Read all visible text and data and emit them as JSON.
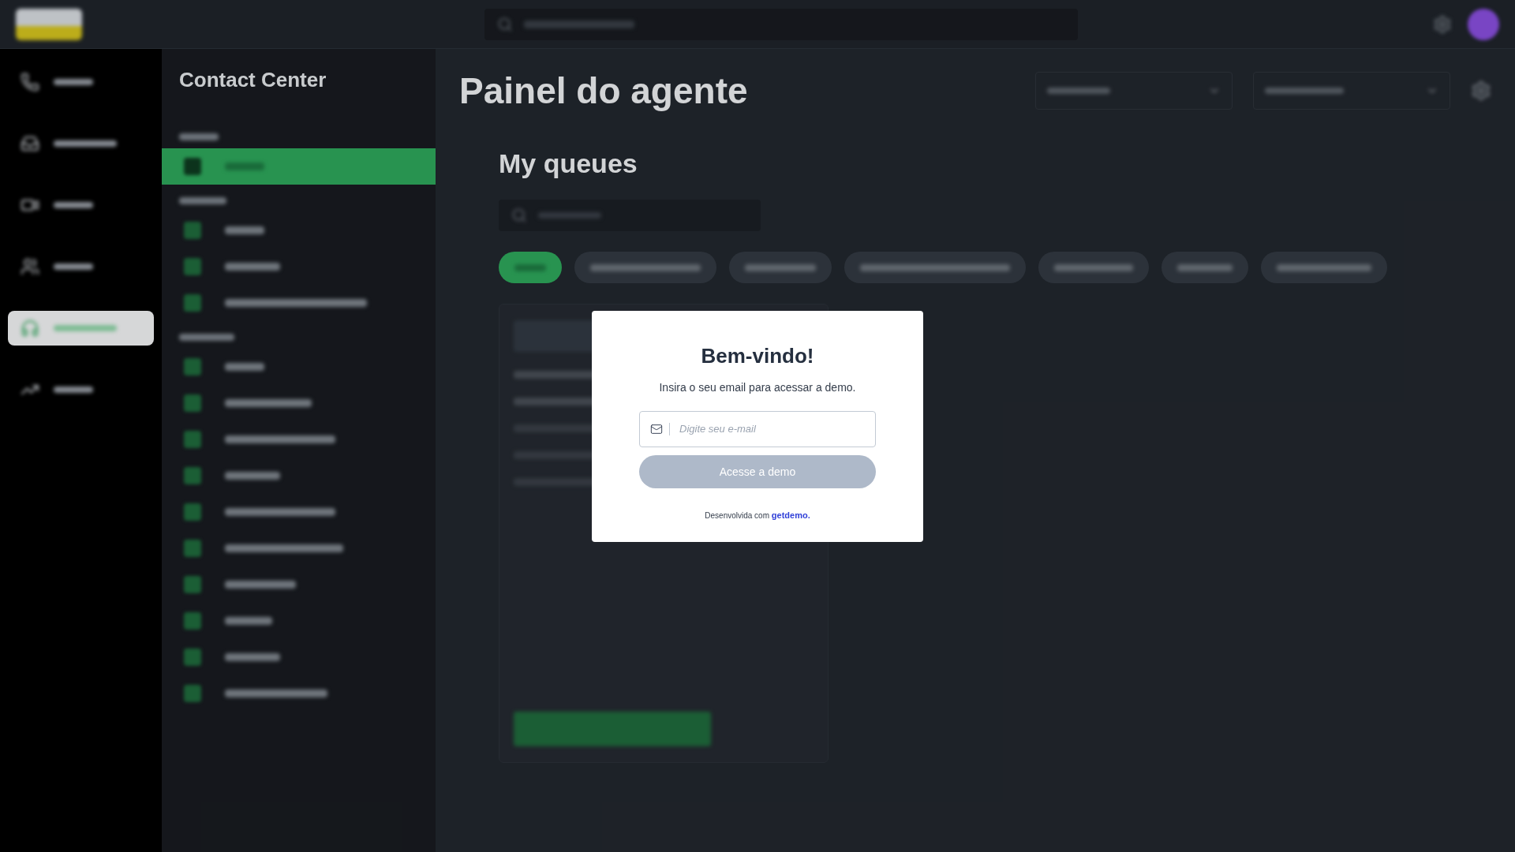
{
  "background": {
    "sidebar_title": "Contact Center",
    "page_title": "Painel do agente",
    "section_title": "My queues",
    "rail_items": [
      {
        "selected": false
      },
      {
        "selected": false
      },
      {
        "selected": false
      },
      {
        "selected": false
      },
      {
        "selected": true
      },
      {
        "selected": false
      }
    ],
    "sidebar_items": [
      {
        "selected": true
      },
      {
        "selected": false
      },
      {
        "selected": false
      },
      {
        "selected": false
      },
      {
        "selected": false
      },
      {
        "selected": false
      },
      {
        "selected": false
      },
      {
        "selected": false
      },
      {
        "selected": false
      },
      {
        "selected": false
      },
      {
        "selected": false
      },
      {
        "selected": false
      },
      {
        "selected": false
      },
      {
        "selected": false
      }
    ],
    "filter_chips": [
      {
        "selected": true
      },
      {
        "selected": false
      },
      {
        "selected": false
      },
      {
        "selected": false
      },
      {
        "selected": false
      },
      {
        "selected": false
      },
      {
        "selected": false
      }
    ]
  },
  "modal": {
    "title": "Bem-vindo!",
    "subtitle": "Insira o seu email para acessar a demo.",
    "email_field": {
      "placeholder": "Digite seu e-mail"
    },
    "submit": {
      "label": "Acesse a demo",
      "disabled": true
    },
    "credit": {
      "text": "Desenvolvida com",
      "link": "getdemo."
    }
  }
}
